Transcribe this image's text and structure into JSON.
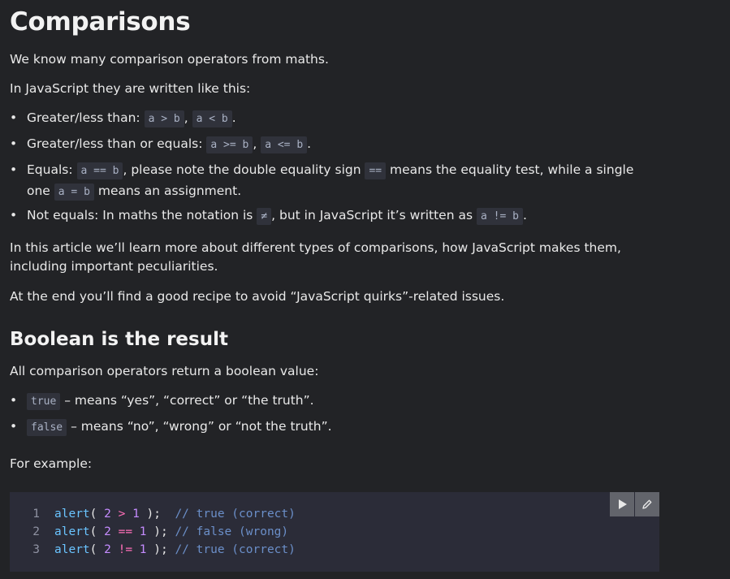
{
  "title": "Comparisons",
  "intro1": "We know many comparison operators from maths.",
  "intro2": "In JavaScript they are written like this:",
  "operators": [
    {
      "text1": "Greater/less than: ",
      "code1": "a > b",
      "sep": ", ",
      "code2": "a < b",
      "text2": "."
    },
    {
      "text1": "Greater/less than or equals: ",
      "code1": "a >= b",
      "sep": ", ",
      "code2": "a <= b",
      "text2": "."
    },
    {
      "text1": "Equals: ",
      "code1": "a == b",
      "mid1": ", please note the double equality sign ",
      "code2": "==",
      "mid2": " means the equality test, while a single one ",
      "code3": "a = b",
      "text2": " means an assignment."
    },
    {
      "text1": "Not equals: In maths the notation is ",
      "code1": "≠",
      "mid1": ", but in JavaScript it’s written as ",
      "code2": "a != b",
      "text2": "."
    }
  ],
  "para1": "In this article we’ll learn more about different types of comparisons, how JavaScript makes them, including important peculiarities.",
  "para2": "At the end you’ll find a good recipe to avoid “JavaScript quirks”-related issues.",
  "section_title": "Boolean is the result",
  "section_intro": "All comparison operators return a boolean value:",
  "booleans": [
    {
      "code": "true",
      "text": " – means “yes”, “correct” or “the truth”."
    },
    {
      "code": "false",
      "text": " – means “no”, “wrong” or “not the truth”."
    }
  ],
  "example_label": "For example:",
  "code_lines": [
    {
      "n": "1",
      "fn": "alert",
      "a": "2",
      "op": ">",
      "b": "1",
      "comment": "// true (correct)"
    },
    {
      "n": "2",
      "fn": "alert",
      "a": "2",
      "op": "==",
      "b": "1",
      "comment": "// false (wrong)"
    },
    {
      "n": "3",
      "fn": "alert",
      "a": "2",
      "op": "!=",
      "b": "1",
      "comment": "// true (correct)"
    }
  ],
  "buttons": {
    "run": "play-icon",
    "edit": "pencil-icon"
  }
}
